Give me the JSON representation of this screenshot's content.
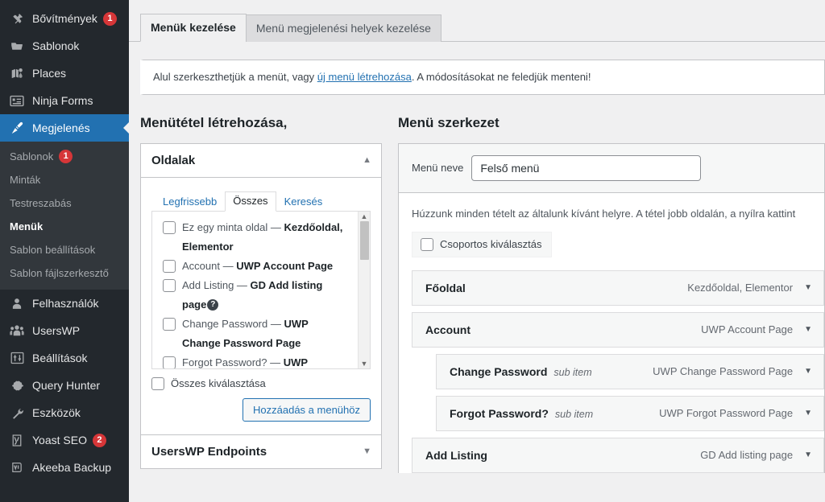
{
  "sidebar": {
    "items": [
      {
        "label": "Bővítmények",
        "icon": "plugin-icon",
        "badge": "1",
        "current": false
      },
      {
        "label": "Sablonok",
        "icon": "folder-icon",
        "badge": "",
        "current": false
      },
      {
        "label": "Places",
        "icon": "map-icon",
        "badge": "",
        "current": false
      },
      {
        "label": "Ninja Forms",
        "icon": "form-icon",
        "badge": "",
        "current": false
      },
      {
        "label": "Megjelenés",
        "icon": "appearance-brush-icon",
        "badge": "",
        "current": true
      }
    ],
    "submenu": [
      {
        "label": "Sablonok",
        "badge": "1",
        "current": false
      },
      {
        "label": "Minták",
        "badge": "",
        "current": false
      },
      {
        "label": "Testreszabás",
        "badge": "",
        "current": false
      },
      {
        "label": "Menük",
        "badge": "",
        "current": true
      },
      {
        "label": "Sablon beállítások",
        "badge": "",
        "current": false
      },
      {
        "label": "Sablon fájlszerkesztő",
        "badge": "",
        "current": false
      }
    ],
    "items_after": [
      {
        "label": "Felhasználók",
        "icon": "user-icon",
        "badge": "",
        "current": false
      },
      {
        "label": "UsersWP",
        "icon": "users-group-icon",
        "badge": "",
        "current": false
      },
      {
        "label": "Beállítások",
        "icon": "settings-sliders-icon",
        "badge": "",
        "current": false
      },
      {
        "label": "Query Hunter",
        "icon": "gear-icon",
        "badge": "",
        "current": false
      },
      {
        "label": "Eszközök",
        "icon": "wrench-icon",
        "badge": "",
        "current": false
      },
      {
        "label": "Yoast SEO",
        "icon": "yoast-icon",
        "badge": "2",
        "current": false
      },
      {
        "label": "Akeeba Backup",
        "icon": "akeeba-icon",
        "badge": "",
        "current": false
      }
    ]
  },
  "tabs": [
    {
      "label": "Menük kezelése",
      "active": true
    },
    {
      "label": "Menü megjelenési helyek kezelése",
      "active": false
    }
  ],
  "notice": {
    "before": "Alul szerkeszthetjük a menüt, vagy ",
    "link": "új menü létrehozása",
    "after": ". A módosításokat ne feledjük menteni!"
  },
  "left_column": {
    "heading": "Menütétel létrehozása,",
    "accordion": {
      "title": "Oldalak",
      "toggle_icon": "chevron-up-icon",
      "tabs": [
        {
          "label": "Legfrissebb",
          "active": false
        },
        {
          "label": "Összes",
          "active": true
        },
        {
          "label": "Keresés",
          "active": false
        }
      ],
      "pages": [
        {
          "title": "Ez egy minta oldal — ",
          "type": "Kezdőoldal, Elementor",
          "help": false
        },
        {
          "title": "Account — ",
          "type": "UWP Account Page",
          "help": false
        },
        {
          "title": "Add Listing — ",
          "type": "GD Add listing page",
          "help": true
        },
        {
          "title": "Change Password — ",
          "type": "UWP Change Password Page",
          "help": false
        },
        {
          "title": "Forgot Password? — ",
          "type": "UWP",
          "help": false
        }
      ],
      "select_all_label": "Összes kiválasztása",
      "add_button": "Hozzáadás a menühöz"
    },
    "accordion2": {
      "title": "UsersWP Endpoints",
      "toggle_icon": "chevron-down-icon"
    }
  },
  "right_column": {
    "heading": "Menü szerkezet",
    "menu_name_label": "Menü neve",
    "menu_name_value": "Felső menü",
    "menu_name_placeholder": "Menü neve",
    "instructions": "Húzzunk minden tételt az általunk kívánt helyre. A tétel jobb oldalán, a nyílra kattint",
    "bulk_select_label": "Csoportos kiválasztás",
    "menu_items": [
      {
        "title": "Főoldal",
        "sub_label": "",
        "type": "Kezdőoldal, Elementor",
        "depth": 0,
        "arrow": "chevron-down-icon"
      },
      {
        "title": "Account",
        "sub_label": "",
        "type": "UWP Account Page",
        "depth": 0,
        "arrow": "chevron-down-icon"
      },
      {
        "title": "Change Password",
        "sub_label": "sub item",
        "type": "UWP Change Password Page",
        "depth": 1,
        "arrow": "chevron-down-icon"
      },
      {
        "title": "Forgot Password?",
        "sub_label": "sub item",
        "type": "UWP Forgot Password Page",
        "depth": 1,
        "arrow": "chevron-down-icon"
      },
      {
        "title": "Add Listing",
        "sub_label": "",
        "type": "GD Add listing page",
        "depth": 0,
        "arrow": "chevron-down-icon"
      }
    ]
  },
  "colors": {
    "sidebar_bg": "#23282d",
    "submenu_bg": "#32373c",
    "accent_blue": "#2271b1",
    "badge_red": "#d63638",
    "content_bg": "#f0f0f1"
  }
}
